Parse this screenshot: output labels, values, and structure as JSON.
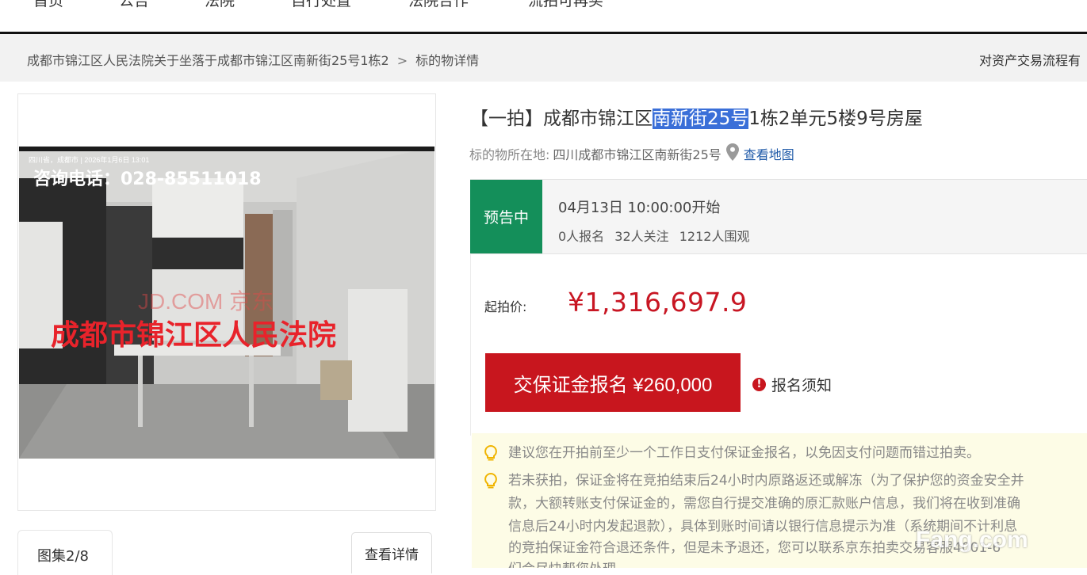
{
  "nav": {
    "items": [
      "首页",
      "公告",
      "法院",
      "自行处置",
      "法院合作",
      "流拍可再买"
    ]
  },
  "breadcrumb": {
    "parent": "成都市锦江区人民法院关于坐落于成都市锦江区南新街25号1栋2",
    "separator": ">",
    "current": "标的物详情",
    "right_link": "对资产交易流程有"
  },
  "gallery": {
    "photo_banner": "咨询电话：028-85511018",
    "photo_stamp": "四川省，成都市 | 2026年1月6日 13:01",
    "photo_court": "成都市锦江区人民法院",
    "photo_watermark": "JD.COM 京东",
    "counter": "图集2/8",
    "detail_button": "查看详情"
  },
  "item": {
    "title_prefix": "【一拍】成都市锦江区",
    "title_highlight": "南新街25号",
    "title_suffix": "1栋2单元5楼9号房屋",
    "location_label": "标的物所在地:",
    "location_value": "四川成都市锦江区南新街25号",
    "map_link": "查看地图"
  },
  "status": {
    "badge": "预告中",
    "start_time": "04月13日 10:00:00开始",
    "registered": "0人报名",
    "followers": "32人关注",
    "watchers": "1212人围观"
  },
  "price": {
    "label": "起拍价:",
    "value": "¥1,316,697.9",
    "register_button": "交保证金报名 ¥260,000",
    "notice_link": "报名须知"
  },
  "tips": {
    "tip1": "建议您在开拍前至少一个工作日支付保证金报名，以免因支付问题而错过拍卖。",
    "tip2_line1": "若未获拍，保证金将在竞拍结束后24小时内原路返还或解冻（为了保护您的资金安全并",
    "tip2_line2": "款，大额转账支付保证金的，需您自行提交准确的原汇款账户信息，我们将在收到准确",
    "tip2_line3": "信息后24小时内发起退款），具体到账时间请以银行信息提示为准（系统期间不计利息",
    "tip2_line4": "的竞拍保证金符合退还条件，但是未予退还，您可以联系京东拍卖交易客服4001-6",
    "tip2_line5": "们会尽快帮您处理。"
  },
  "watermark": {
    "site": "Fang.com"
  },
  "colors": {
    "accent_red": "#c8161e",
    "status_green": "#148f5a",
    "highlight_blue": "#3a6fd8",
    "link_blue": "#1f5aa8",
    "tip_bg": "#fdfce6"
  }
}
